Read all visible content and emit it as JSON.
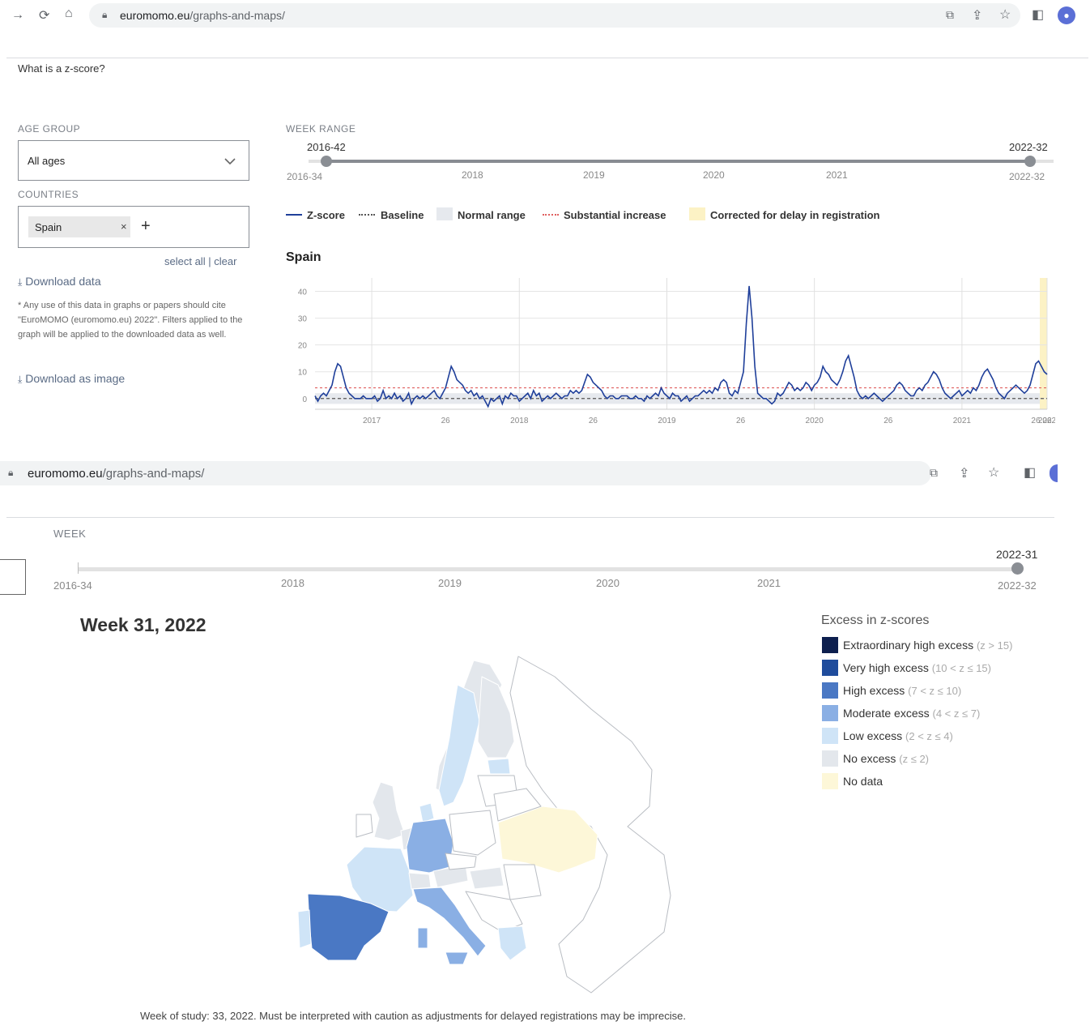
{
  "browser1": {
    "domain": "euromomo.eu",
    "path": "/graphs-and-maps/"
  },
  "browser2": {
    "domain": "euromomo.eu",
    "path": "/graphs-and-maps/"
  },
  "top_link": "What is a z-score?",
  "filters": {
    "age_group_label": "AGE GROUP",
    "age_group_value": "All ages",
    "countries_label": "COUNTRIES",
    "country_tag": "Spain",
    "select_all": "select all",
    "separator": "|",
    "clear": "clear",
    "download_data": "Download data",
    "note": "* Any use of this data in graphs or papers should cite \"EuroMOMO (euromomo.eu) 2022\". Filters applied to the graph will be applied to the downloaded data as well.",
    "download_image": "Download as image"
  },
  "week_range": {
    "label": "WEEK RANGE",
    "start_handle": "2016-42",
    "end_handle": "2022-32",
    "min": "2016-34",
    "max": "2022-32",
    "ticks": [
      "2018",
      "2019",
      "2020",
      "2021"
    ]
  },
  "legend": {
    "zscore": "Z-score",
    "baseline": "Baseline",
    "normal": "Normal range",
    "substantial": "Substantial increase",
    "corrected": "Corrected for delay in registration"
  },
  "chart_title": "Spain",
  "chart_data": {
    "type": "line",
    "title": "Spain",
    "y_ticks": [
      "0",
      "10",
      "20",
      "30",
      "40"
    ],
    "x_ticks": [
      "2017",
      "26",
      "2018",
      "26",
      "2019",
      "26",
      "2020",
      "26",
      "2021",
      "26",
      "2022",
      "26"
    ],
    "ylim": [
      -4,
      45
    ],
    "baseline": 0,
    "substantial_increase": 4,
    "normal_range": [
      -2,
      2
    ],
    "series": [
      {
        "values": [
          1,
          -1,
          1,
          2,
          1,
          3,
          5,
          10,
          13,
          12,
          8,
          4,
          2,
          1,
          0,
          0,
          0,
          1,
          0,
          0,
          0,
          1,
          -1,
          0,
          3,
          0,
          1,
          0,
          2,
          0,
          1,
          -1,
          0,
          2,
          -2,
          0,
          1,
          0,
          1,
          0,
          1,
          2,
          3,
          1,
          0,
          2,
          4,
          8,
          12,
          10,
          7,
          6,
          5,
          3,
          2,
          3,
          1,
          2,
          0,
          1,
          -1,
          -3,
          0,
          -1,
          0,
          1,
          -2,
          1,
          0,
          2,
          1,
          1,
          -1,
          0,
          1,
          2,
          0,
          3,
          1,
          2,
          -1,
          0,
          1,
          0,
          1,
          2,
          1,
          0,
          1,
          1,
          3,
          2,
          3,
          2,
          3,
          6,
          9,
          8,
          6,
          5,
          4,
          3,
          1,
          0,
          1,
          1,
          0,
          0,
          1,
          1,
          1,
          0,
          0,
          1,
          0,
          0,
          -1,
          1,
          0,
          1,
          2,
          1,
          4,
          2,
          1,
          0,
          2,
          1,
          1,
          -1,
          0,
          1,
          -1,
          0,
          1,
          1,
          2,
          3,
          2,
          3,
          2,
          4,
          3,
          6,
          7,
          6,
          2,
          1,
          3,
          2,
          6,
          10,
          28,
          42,
          30,
          12,
          2,
          1,
          0,
          0,
          -1,
          -2,
          -1,
          2,
          1,
          2,
          4,
          6,
          5,
          3,
          4,
          3,
          4,
          6,
          5,
          3,
          5,
          6,
          8,
          12,
          10,
          9,
          7,
          6,
          5,
          7,
          10,
          14,
          16,
          12,
          8,
          3,
          1,
          0,
          1,
          0,
          1,
          2,
          1,
          0,
          -1,
          0,
          1,
          2,
          3,
          5,
          6,
          5,
          3,
          2,
          1,
          1,
          3,
          4,
          3,
          5,
          6,
          8,
          10,
          9,
          7,
          4,
          2,
          1,
          0,
          1,
          2,
          3,
          1,
          2,
          3,
          2,
          4,
          3,
          5,
          8,
          10,
          11,
          9,
          7,
          4,
          2,
          1,
          0,
          2,
          3,
          4,
          5,
          4,
          3,
          2,
          3,
          5,
          9,
          13,
          14,
          12,
          10,
          9
        ]
      }
    ]
  },
  "map_section": {
    "week_label": "WEEK",
    "slider_handle": "2022-31",
    "slider_min": "2016-34",
    "slider_max": "2022-32",
    "slider_ticks": [
      "2018",
      "2019",
      "2020",
      "2021"
    ],
    "map_title": "Week 31, 2022",
    "legend_title": "Excess in z-scores",
    "legend_items": [
      {
        "label": "Extraordinary high excess",
        "range": "(z > 15)",
        "color": "#0d1f4e"
      },
      {
        "label": "Very high excess",
        "range": "(10 < z ≤ 15)",
        "color": "#1f4c9c"
      },
      {
        "label": "High excess",
        "range": "(7 < z ≤ 10)",
        "color": "#4a78c4"
      },
      {
        "label": "Moderate excess",
        "range": "(4 < z ≤ 7)",
        "color": "#8aafe4"
      },
      {
        "label": "Low excess",
        "range": "(2 < z ≤ 4)",
        "color": "#cfe4f7"
      },
      {
        "label": "No excess",
        "range": "(z ≤ 2)",
        "color": "#e3e7ec"
      },
      {
        "label": "No data",
        "range": "",
        "color": "#fdf7d8"
      }
    ],
    "footnote": "Week of study: 33, 2022. Must be interpreted with caution as adjustments for delayed registrations may be imprecise."
  }
}
